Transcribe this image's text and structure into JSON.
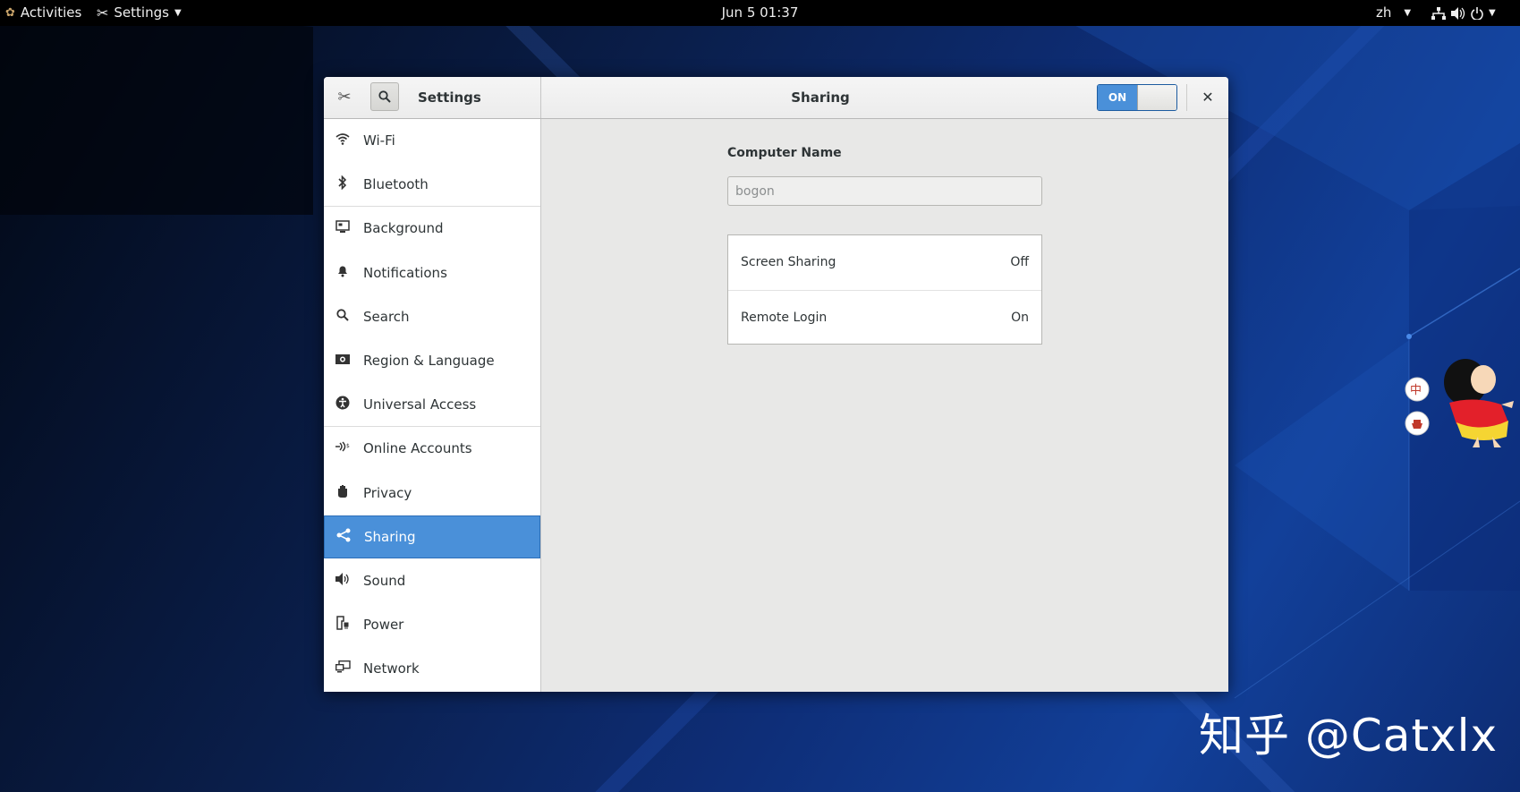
{
  "topbar": {
    "activities": "Activities",
    "app_menu": "Settings",
    "clock": "Jun 5  01:37",
    "language": "zh"
  },
  "window": {
    "sidebar_title": "Settings",
    "panel_title": "Sharing",
    "switch_label": "ON",
    "switch_state": true
  },
  "sidebar": {
    "items": [
      {
        "label": "Wi-Fi",
        "icon": "wifi-icon"
      },
      {
        "label": "Bluetooth",
        "icon": "bluetooth-icon"
      },
      {
        "label": "Background",
        "icon": "background-icon"
      },
      {
        "label": "Notifications",
        "icon": "bell-icon"
      },
      {
        "label": "Search",
        "icon": "search-icon"
      },
      {
        "label": "Region & Language",
        "icon": "region-icon"
      },
      {
        "label": "Universal Access",
        "icon": "accessibility-icon"
      },
      {
        "label": "Online Accounts",
        "icon": "online-accounts-icon"
      },
      {
        "label": "Privacy",
        "icon": "hand-icon"
      },
      {
        "label": "Sharing",
        "icon": "share-icon",
        "selected": true
      },
      {
        "label": "Sound",
        "icon": "speaker-icon"
      },
      {
        "label": "Power",
        "icon": "power-plug-icon"
      },
      {
        "label": "Network",
        "icon": "network-icon"
      }
    ]
  },
  "sharing": {
    "computer_name_label": "Computer Name",
    "computer_name_value": "bogon",
    "services": [
      {
        "label": "Screen Sharing",
        "status": "Off"
      },
      {
        "label": "Remote Login",
        "status": "On"
      }
    ]
  },
  "watermark": "知乎 @Catxlx",
  "ime": {
    "mode_char": "中"
  },
  "colors": {
    "accent": "#4a90d9",
    "topbar": "#000000"
  }
}
